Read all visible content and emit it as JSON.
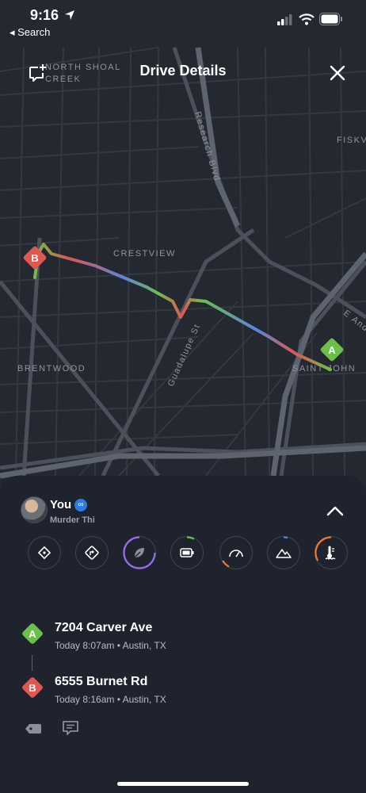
{
  "status": {
    "time": "9:16",
    "back_label": "◂ Search"
  },
  "header": {
    "title": "Drive Details"
  },
  "map": {
    "labels": {
      "shoal_creek_1": "NORTH SHOAL",
      "shoal_creek_2": "CREEK",
      "research": "Research Blvd",
      "fisk": "FISKV",
      "crestview": "CRESTVIEW",
      "e_and": "E And",
      "brentwood": "BRENTWOOD",
      "saint_john": "SAINT JOHN",
      "guadalupe": "Guadalupe St"
    },
    "marker_a": "A",
    "marker_b": "B"
  },
  "colors": {
    "start_green": "#6cc04a",
    "end_red": "#e0574f",
    "route_blue": "#5b86d8",
    "accent_purple": "#9b6cf0",
    "accent_orange": "#f07a2a"
  },
  "driver": {
    "name": "You",
    "subtitle": "Murder Thi"
  },
  "metrics": [
    {
      "icon": "diamond-dot-icon"
    },
    {
      "icon": "turn-diamond-icon"
    },
    {
      "icon": "leaf-icon"
    },
    {
      "icon": "battery-icon"
    },
    {
      "icon": "speedometer-icon"
    },
    {
      "icon": "mountain-icon"
    },
    {
      "icon": "thermometer-icon"
    }
  ],
  "trip": {
    "start": {
      "badge": "A",
      "address": "7204 Carver Ave",
      "meta": "Today 8:07am • Austin, TX"
    },
    "end": {
      "badge": "B",
      "address": "6555 Burnet Rd",
      "meta": "Today 8:16am • Austin, TX"
    }
  }
}
